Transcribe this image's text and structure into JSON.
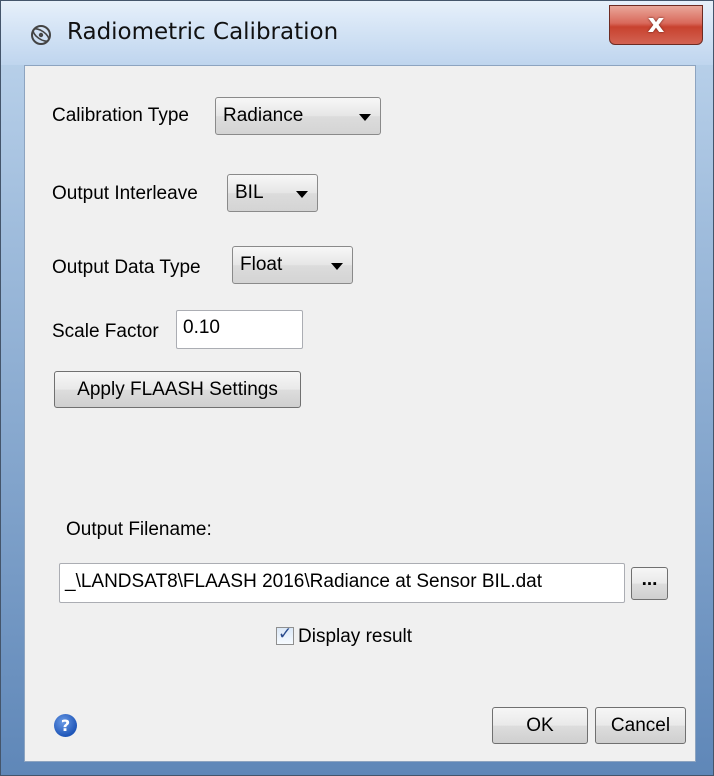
{
  "window": {
    "title": "Radiometric Calibration",
    "close_glyph": "x"
  },
  "form": {
    "calibration_type": {
      "label": "Calibration Type",
      "value": "Radiance"
    },
    "output_interleave": {
      "label": "Output Interleave",
      "value": "BIL"
    },
    "output_data_type": {
      "label": "Output Data Type",
      "value": "Float"
    },
    "scale_factor": {
      "label": "Scale Factor",
      "value": "0.10"
    },
    "apply_flaash_label": "Apply FLAASH Settings"
  },
  "output": {
    "filename_label": "Output Filename:",
    "filename_value": "_\\LANDSAT8\\FLAASH 2016\\Radiance at Sensor BIL.dat",
    "browse_label": "..."
  },
  "display_result": {
    "label": "Display result",
    "checked": true
  },
  "footer": {
    "help_glyph": "?",
    "ok_label": "OK",
    "cancel_label": "Cancel"
  },
  "colors": {
    "title_bar": "#d6e5f6",
    "close_button": "#c8422f",
    "client_bg": "#f0f0f0",
    "help_icon": "#1f56b8"
  }
}
